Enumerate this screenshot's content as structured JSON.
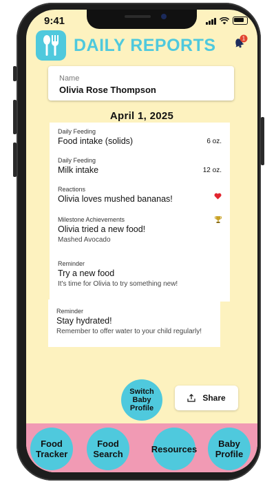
{
  "status_bar": {
    "time": "9:41"
  },
  "header": {
    "title": "DAILY REPORTS",
    "logo_icon": "fork-spoon-icon",
    "notification_count": "1"
  },
  "profile": {
    "name_label": "Name",
    "name_value": "Olivia Rose Thompson"
  },
  "report_date": "April 1, 2025",
  "entries": [
    {
      "category": "Daily Feeding",
      "text": "Food intake (solids)",
      "aside": "6 oz.",
      "sub": ""
    },
    {
      "category": "Daily Feeding",
      "text": "Milk intake",
      "aside": "12 oz.",
      "sub": ""
    },
    {
      "category": "Reactions",
      "text": "Olivia loves mushed bananas!",
      "aside": "heart-icon",
      "sub": ""
    },
    {
      "category": "Milestone Achievements",
      "text": "Olivia tried a new food!",
      "aside": "trophy-icon",
      "sub": "Mashed Avocado"
    },
    {
      "category": "Reminder",
      "text": "Try a new food",
      "aside": "",
      "sub": "It's time for Olivia to try something new!"
    },
    {
      "category": "Reminder",
      "text": "Stay hydrated!",
      "aside": "",
      "sub": "Remember to offer water to your child regularly!"
    }
  ],
  "actions": {
    "switch_profile": "Switch Baby Profile",
    "share": "Share"
  },
  "bottom_nav": [
    {
      "label": "Food Tracker"
    },
    {
      "label": "Food Search"
    },
    {
      "label": "Resources"
    },
    {
      "label": "Baby Profile"
    }
  ],
  "colors": {
    "accent": "#4fc9dd",
    "background": "#fdf2bf",
    "nav_bg": "#f19ab4",
    "badge": "#e2452f"
  }
}
